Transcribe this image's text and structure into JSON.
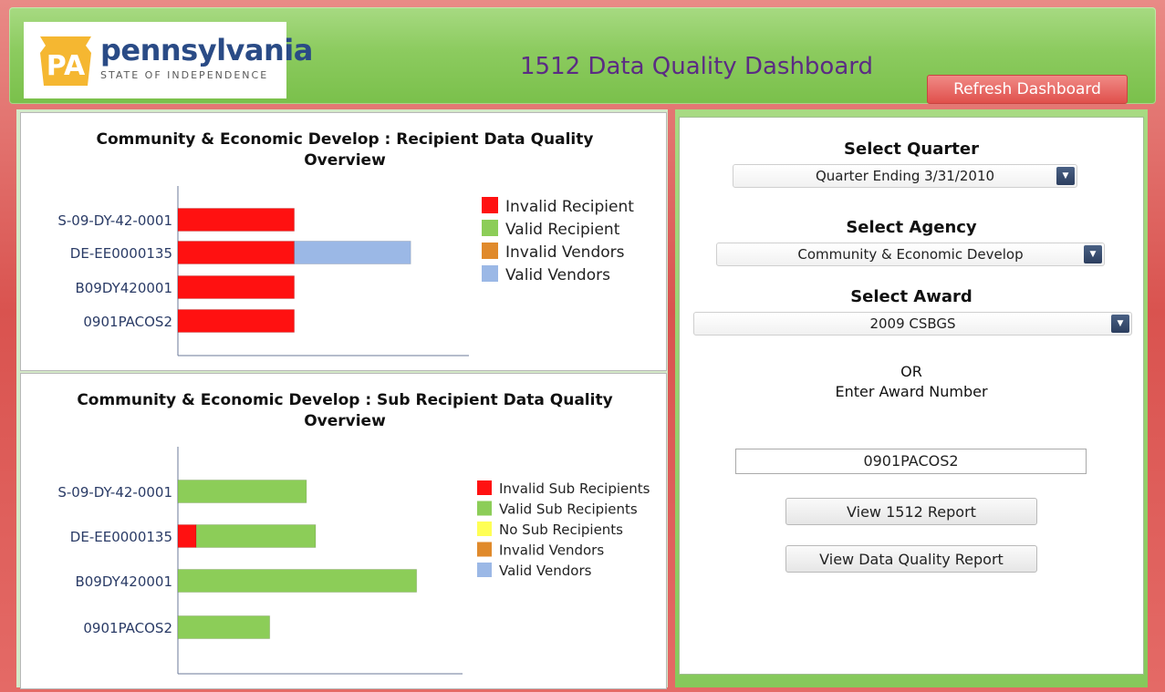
{
  "header": {
    "logo_mark": "PA",
    "logo_name": "pennsylvania",
    "logo_tagline": "STATE OF INDEPENDENCE",
    "title": "1512 Data Quality Dashboard",
    "refresh_label": "Refresh Dashboard"
  },
  "colors": {
    "invalid": "#ff1111",
    "valid_green": "#8ccd58",
    "no_sub": "#ffff55",
    "invalid_vendor": "#e08a2c",
    "valid_vendor": "#9bb8e6"
  },
  "chart_data": [
    {
      "type": "bar",
      "orientation": "horizontal",
      "stacked": true,
      "title": "Community & Economic Develop : Recipient Data Quality Overview",
      "categories": [
        "S-09-DY-42-0001",
        "DE-EE0000135",
        "B09DY420001",
        "0901PACOS2"
      ],
      "series": [
        {
          "name": "Invalid Recipient",
          "color": "#ff1111",
          "values": [
            1,
            1,
            1,
            1
          ]
        },
        {
          "name": "Valid Recipient",
          "color": "#8ccd58",
          "values": [
            0,
            0,
            0,
            0
          ]
        },
        {
          "name": "Invalid Vendors",
          "color": "#e08a2c",
          "values": [
            0,
            0,
            0,
            0
          ]
        },
        {
          "name": "Valid Vendors",
          "color": "#9bb8e6",
          "values": [
            0,
            1,
            0,
            0
          ]
        }
      ],
      "xlim": [
        0,
        2.5
      ],
      "legend": "right"
    },
    {
      "type": "bar",
      "orientation": "horizontal",
      "stacked": true,
      "title": "Community & Economic Develop : Sub Recipient Data Quality Overview",
      "categories": [
        "S-09-DY-42-0001",
        "DE-EE0000135",
        "B09DY420001",
        "0901PACOS2"
      ],
      "series": [
        {
          "name": "Invalid Sub Recipients",
          "color": "#ff1111",
          "values": [
            0,
            1,
            0,
            0
          ]
        },
        {
          "name": "Valid Sub Recipients",
          "color": "#8ccd58",
          "values": [
            7,
            6.5,
            13,
            5
          ]
        },
        {
          "name": "No Sub Recipients",
          "color": "#ffff55",
          "values": [
            0,
            0,
            0,
            0
          ]
        },
        {
          "name": "Invalid Vendors",
          "color": "#e08a2c",
          "values": [
            0,
            0,
            0,
            0
          ]
        },
        {
          "name": "Valid Vendors",
          "color": "#9bb8e6",
          "values": [
            0,
            0,
            0,
            0
          ]
        }
      ],
      "xlim": [
        0,
        15.5
      ],
      "legend": "right"
    }
  ],
  "form": {
    "quarter_label": "Select Quarter",
    "quarter_value": "Quarter Ending 3/31/2010",
    "agency_label": "Select Agency",
    "agency_value": "Community & Economic Develop",
    "award_label": "Select Award",
    "award_value": "2009 CSBGS",
    "or_text": "OR",
    "enter_award_label": "Enter Award Number",
    "award_number_value": "0901PACOS2",
    "view_1512_label": "View 1512 Report",
    "view_dq_label": "View Data Quality Report"
  }
}
